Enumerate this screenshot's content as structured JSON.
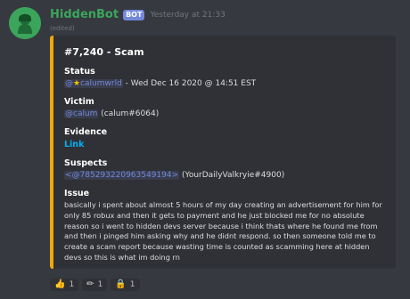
{
  "message": {
    "username": "HiddenBot",
    "badge": "BOT",
    "timestamp": "Yesterday at 21:33",
    "edited": "(edited)"
  },
  "embed": {
    "title": "#7,240 - Scam",
    "accent_color": "#f0a70a",
    "status": {
      "label": "Status",
      "mention_prefix": "@",
      "mention_star": "★",
      "mention_name": "calumwrld",
      "suffix": " - Wed Dec 16 2020 @ 14:51 EST"
    },
    "victim": {
      "label": "Victim",
      "mention": "@calum",
      "suffix": " (calum#6064)"
    },
    "evidence": {
      "label": "Evidence",
      "link": "Link"
    },
    "suspects": {
      "label": "Suspects",
      "mention": "<@785293220963549194>",
      "suffix": " (YourDailyValkryie#4900)"
    },
    "issue": {
      "label": "Issue",
      "text": "basically i spent about almost 5 hours of my day creating an advertisement for him for only 85 robux and then it gets to payment and he just blocked me for no absolute reason so i went to hidden devs server because i think thats where he found me from and then i pinged him asking why and he didnt respond. so then someone told me to create a scam report because wasting time is counted as scamming here at hidden devs so this is what im doing rn"
    }
  },
  "reactions": [
    {
      "icon": "thumbs-up",
      "glyph": "👍",
      "count": "1"
    },
    {
      "icon": "pencil",
      "glyph": "✏",
      "count": "1"
    },
    {
      "icon": "lock",
      "glyph": "🔒",
      "count": "1"
    }
  ]
}
